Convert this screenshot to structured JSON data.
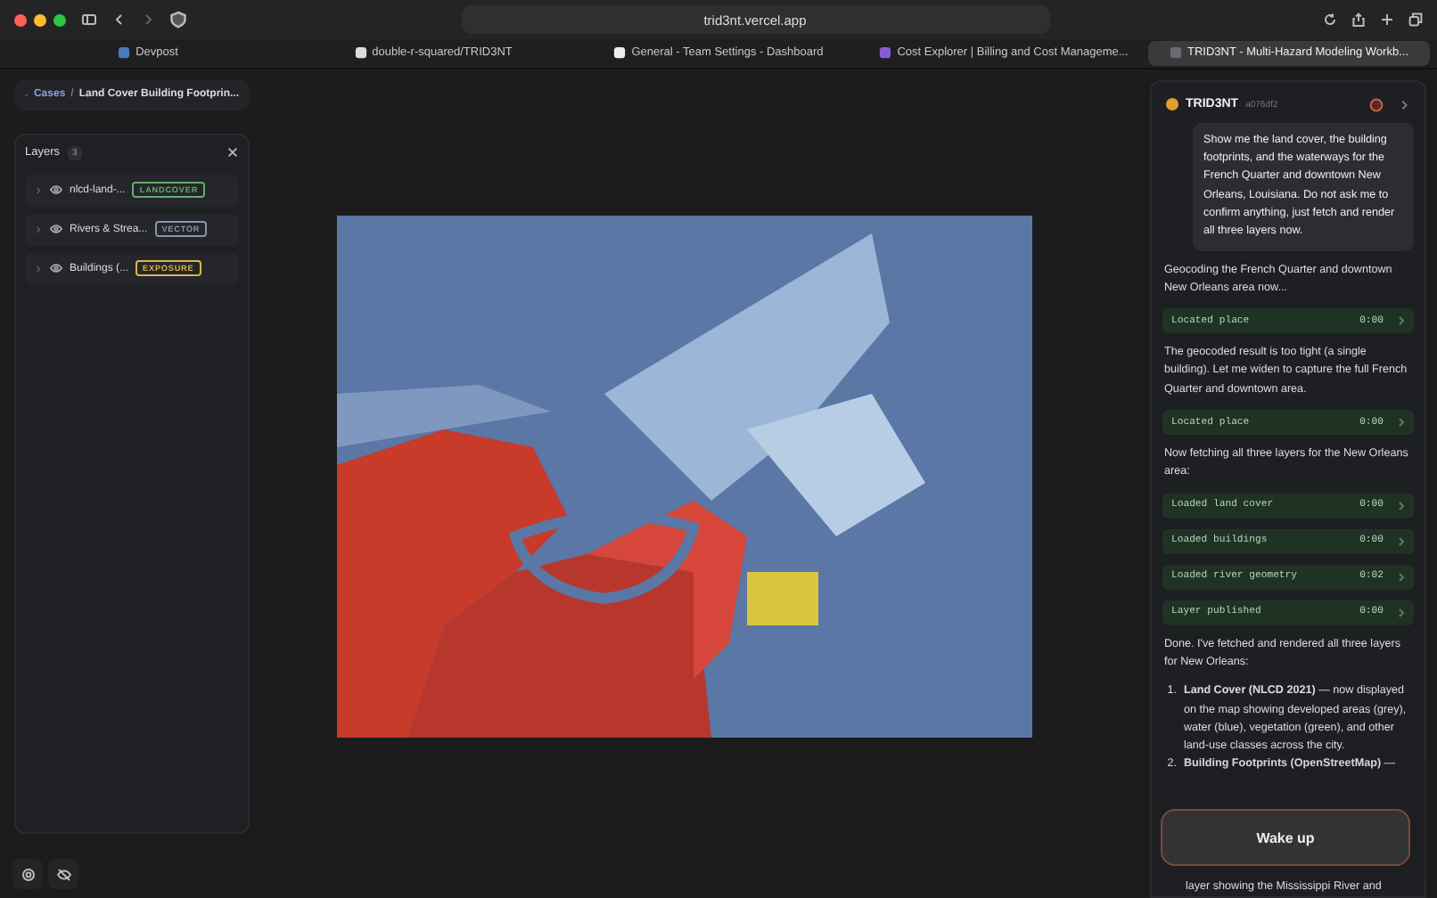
{
  "browser": {
    "address": "trid3nt.vercel.app"
  },
  "tabs": [
    {
      "label": "Devpost",
      "selected": false
    },
    {
      "label": "double-r-squared/TRID3NT",
      "selected": false
    },
    {
      "label": "General - Team Settings - Dashboard",
      "selected": false
    },
    {
      "label": "Cost Explorer | Billing and Cost Manageme...",
      "selected": false
    },
    {
      "label": "TRID3NT - Multi-Hazard Modeling Workb...",
      "selected": true
    }
  ],
  "breadcrumb": {
    "root": "Cases",
    "separator": "/",
    "current": "Land Cover Building Footprin..."
  },
  "layers_panel": {
    "title": "Layers",
    "count": "3",
    "layers": [
      {
        "name": "nlcd-land-...",
        "tag": "LANDCOVER",
        "color": "#5fae6a"
      },
      {
        "name": "Rivers & Strea...",
        "tag": "VECTOR",
        "color": "#8a93a6"
      },
      {
        "name": "Buildings (...",
        "tag": "EXPOSURE",
        "color": "#d9b44a"
      }
    ]
  },
  "chat": {
    "title": "TRID3NT",
    "commit": "a076df2",
    "messages": [
      {
        "kind": "user",
        "text": "Show me the land cover, the building footprints, and the waterways for the French Quarter and downtown New Orleans, Louisiana. Do not ask me to confirm anything, just fetch and render all three layers now."
      },
      {
        "kind": "text",
        "text": "Geocoding the French Quarter and downtown New Orleans area now..."
      },
      {
        "kind": "tool",
        "label": "Located place",
        "time": "0:00"
      },
      {
        "kind": "text",
        "text": "The geocoded result is too tight (a single building). Let me widen to capture the full French Quarter and downtown area."
      },
      {
        "kind": "tool",
        "label": "Located place",
        "time": "0:00"
      },
      {
        "kind": "text",
        "text": "Now fetching all three layers for the New Orleans area:"
      },
      {
        "kind": "tool",
        "label": "Loaded land cover",
        "time": "0:00"
      },
      {
        "kind": "tool",
        "label": "Loaded buildings",
        "time": "0:00"
      },
      {
        "kind": "tool",
        "label": "Loaded river geometry",
        "time": "0:02"
      },
      {
        "kind": "tool",
        "label": "Layer published",
        "time": "0:00"
      },
      {
        "kind": "text",
        "text": "Done. I've fetched and rendered all three layers for New Orleans:"
      },
      {
        "kind": "list",
        "items": [
          {
            "marker": "1.",
            "text": "**Land Cover (NLCD 2021)** — now displayed on the map showing developed areas (grey), water (blue), vegetation (green), and other land-use classes across the city."
          },
          {
            "marker": "2.",
            "text": "**Building Footprints (OpenStreetMap)** —"
          }
        ]
      },
      {
        "kind": "continuation",
        "text": "layer showing the Mississippi River and"
      }
    ]
  },
  "wake_button": "Wake up"
}
